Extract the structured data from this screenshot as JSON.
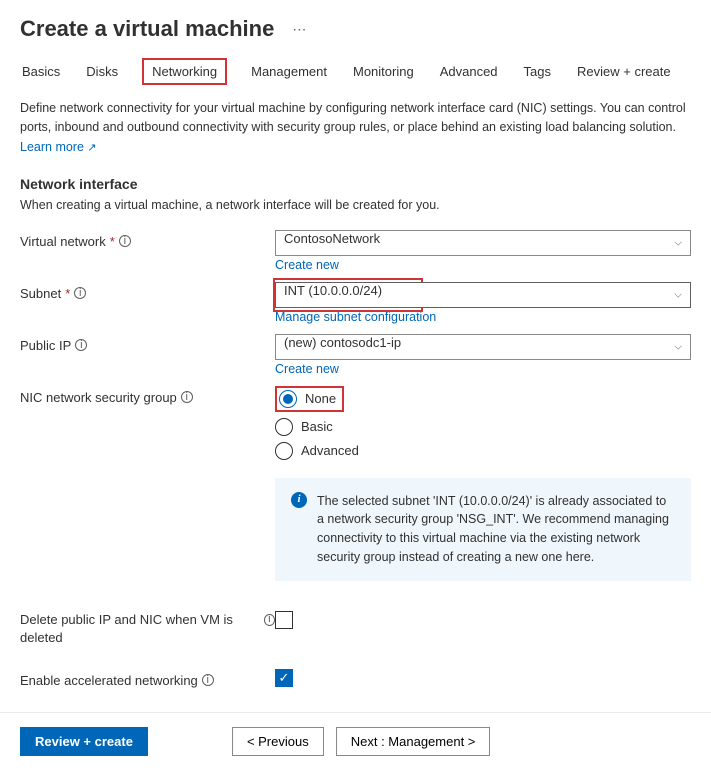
{
  "header": {
    "title": "Create a virtual machine"
  },
  "tabs": [
    "Basics",
    "Disks",
    "Networking",
    "Management",
    "Monitoring",
    "Advanced",
    "Tags",
    "Review + create"
  ],
  "activeTab": "Networking",
  "intro": {
    "text": "Define network connectivity for your virtual machine by configuring network interface card (NIC) settings. You can control ports, inbound and outbound connectivity with security group rules, or place behind an existing load balancing solution.",
    "learnMore": "Learn more"
  },
  "section": {
    "title": "Network interface",
    "desc": "When creating a virtual machine, a network interface will be created for you."
  },
  "fields": {
    "vnet": {
      "label": "Virtual network",
      "value": "ContosoNetwork",
      "createNew": "Create new"
    },
    "subnet": {
      "label": "Subnet",
      "value": "INT (10.0.0.0/24)",
      "manage": "Manage subnet configuration"
    },
    "publicIp": {
      "label": "Public IP",
      "value": "(new) contosodc1-ip",
      "createNew": "Create new"
    },
    "nsg": {
      "label": "NIC network security group",
      "options": [
        "None",
        "Basic",
        "Advanced"
      ],
      "selected": "None"
    },
    "delete": {
      "label": "Delete public IP and NIC when VM is deleted"
    },
    "accel": {
      "label": "Enable accelerated networking"
    }
  },
  "infobox": {
    "text": "The selected subnet 'INT (10.0.0.0/24)' is already associated to a network security group 'NSG_INT'. We recommend managing connectivity to this virtual machine via the existing network security group instead of creating a new one here."
  },
  "footer": {
    "review": "Review + create",
    "prev": "< Previous",
    "next": "Next : Management >"
  }
}
